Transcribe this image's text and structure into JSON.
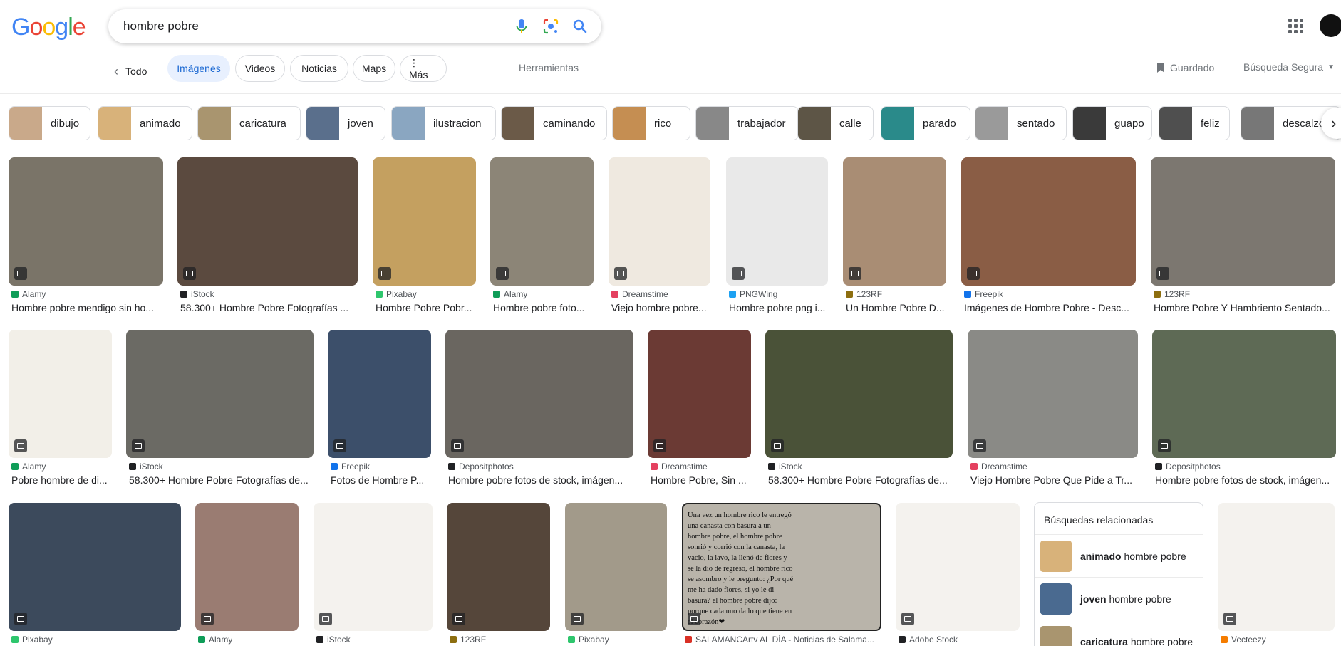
{
  "logo": {
    "letters": [
      "G",
      "o",
      "o",
      "g",
      "l",
      "e"
    ],
    "colors": [
      "#4285F4",
      "#EA4335",
      "#FBBC05",
      "#4285F4",
      "#34A853",
      "#EA4335"
    ]
  },
  "search": {
    "value": "hombre pobre",
    "mic_icon": "mic-icon",
    "lens_icon": "lens-icon",
    "search_icon": "search-icon"
  },
  "nav": {
    "back": "Todo",
    "tabs": [
      "Imágenes",
      "Videos",
      "Noticias",
      "Maps",
      "⋮ Más"
    ],
    "tools": "Herramientas",
    "saved": "Guardado",
    "safe_search": "Búsqueda Segura"
  },
  "refine": [
    {
      "label": "dibujo",
      "color": "#c9a98a"
    },
    {
      "label": "animado",
      "color": "#d8b27a"
    },
    {
      "label": "caricatura",
      "color": "#a9956f"
    },
    {
      "label": "joven",
      "color": "#5a6f8c"
    },
    {
      "label": "ilustracion",
      "color": "#8aa6c1"
    },
    {
      "label": "caminando",
      "color": "#6b5a48"
    },
    {
      "label": "rico",
      "color": "#c58e52"
    },
    {
      "label": "trabajador",
      "color": "#888888"
    },
    {
      "label": "calle",
      "color": "#5d5546"
    },
    {
      "label": "parado",
      "color": "#2a8a8a"
    },
    {
      "label": "sentado",
      "color": "#9a9a9a"
    },
    {
      "label": "guapo",
      "color": "#3a3a3a"
    },
    {
      "label": "feliz",
      "color": "#4f4f4f"
    },
    {
      "label": "descalzo",
      "color": "#777777"
    }
  ],
  "results_row1": [
    {
      "source": "Alamy",
      "fav": "#0f9d58",
      "title": "Hombre pobre mendigo sin ho...",
      "color": "#7a7468"
    },
    {
      "source": "iStock",
      "fav": "#202124",
      "title": "58.300+ Hombre Pobre Fotografías ...",
      "color": "#5b4a3f"
    },
    {
      "source": "Pixabay",
      "fav": "#2ec66d",
      "title": "Hombre Pobre Pobr...",
      "color": "#c4a060"
    },
    {
      "source": "Alamy",
      "fav": "#0f9d58",
      "title": "Hombre pobre foto...",
      "color": "#8c8577"
    },
    {
      "source": "Dreamstime",
      "fav": "#e4405f",
      "title": "Viejo hombre pobre...",
      "color": "#efe9e0"
    },
    {
      "source": "PNGWing",
      "fav": "#1da1f2",
      "title": "Hombre pobre png i...",
      "color": "#e9e9e9"
    },
    {
      "source": "123RF",
      "fav": "#8d6e0f",
      "title": "Un Hombre Pobre D...",
      "color": "#a98d74"
    },
    {
      "source": "Freepik",
      "fav": "#1273eb",
      "title": "Imágenes de Hombre Pobre - Desc...",
      "color": "#8a5d45"
    },
    {
      "source": "123RF",
      "fav": "#8d6e0f",
      "title": "Hombre Pobre Y Hambriento Sentado...",
      "color": "#7c7770"
    }
  ],
  "results_row2": [
    {
      "source": "Alamy",
      "fav": "#0f9d58",
      "title": "Pobre hombre de di...",
      "color": "#f2efe8"
    },
    {
      "source": "iStock",
      "fav": "#202124",
      "title": "58.300+ Hombre Pobre Fotografías de...",
      "color": "#6b6a64"
    },
    {
      "source": "Freepik",
      "fav": "#1273eb",
      "title": "Fotos de Hombre P...",
      "color": "#3c4f6a"
    },
    {
      "source": "Depositphotos",
      "fav": "#202124",
      "title": "Hombre pobre fotos de stock, imágen...",
      "color": "#6a6660"
    },
    {
      "source": "Dreamstime",
      "fav": "#e4405f",
      "title": "Hombre Pobre, Sin ...",
      "color": "#6b3a34"
    },
    {
      "source": "iStock",
      "fav": "#202124",
      "title": "58.300+ Hombre Pobre Fotografías de...",
      "color": "#4a5238"
    },
    {
      "source": "Dreamstime",
      "fav": "#e4405f",
      "title": "Viejo Hombre Pobre Que Pide a Tr...",
      "color": "#8a8a86"
    },
    {
      "source": "Depositphotos",
      "fav": "#202124",
      "title": "Hombre pobre fotos de stock, imágen...",
      "color": "#5e6a55"
    }
  ],
  "results_row3": [
    {
      "source": "Pixabay",
      "fav": "#2ec66d",
      "color": "#3c4a5c"
    },
    {
      "source": "Alamy",
      "fav": "#0f9d58",
      "color": "#9a7c72"
    },
    {
      "source": "iStock",
      "fav": "#202124",
      "color": "#f4f2ee"
    },
    {
      "source": "123RF",
      "fav": "#8d6e0f",
      "color": "#55463a"
    },
    {
      "source": "Pixabay",
      "fav": "#2ec66d",
      "color": "#a29a8a"
    },
    {
      "source": "SALAMANCArtv AL DÍA - Noticias de Salama...",
      "fav": "#d93025",
      "color": "#b9b4aa"
    },
    {
      "source": "Adobe Stock",
      "fav": "#202124",
      "color": "#f4f2ee"
    },
    {
      "source": "Vecteezy",
      "fav": "#f57c00",
      "color": "#f4f2ee"
    }
  ],
  "quote_text": "Una vez un hombre rico le entregó una canasta con basura a un hombre pobre, el hombre pobre sonrió y corrió con la canasta, la vacio, la lavo, la llenó de flores y se la dio de regreso, el hombre rico se asombro y le pregunto: ¿Por qué me ha dado flores, si yo le di basura? el hombre pobre dijo: porque cada uno da lo que tiene en el corazón❤",
  "related": {
    "title": "Búsquedas relacionadas",
    "items": [
      {
        "bold": "animado",
        "rest": " hombre pobre",
        "color": "#d8b27a"
      },
      {
        "bold": "joven",
        "rest": " hombre pobre",
        "color": "#4a6a90"
      },
      {
        "bold": "caricatura",
        "rest": " hombre pobre",
        "color": "#a9956f"
      }
    ]
  }
}
